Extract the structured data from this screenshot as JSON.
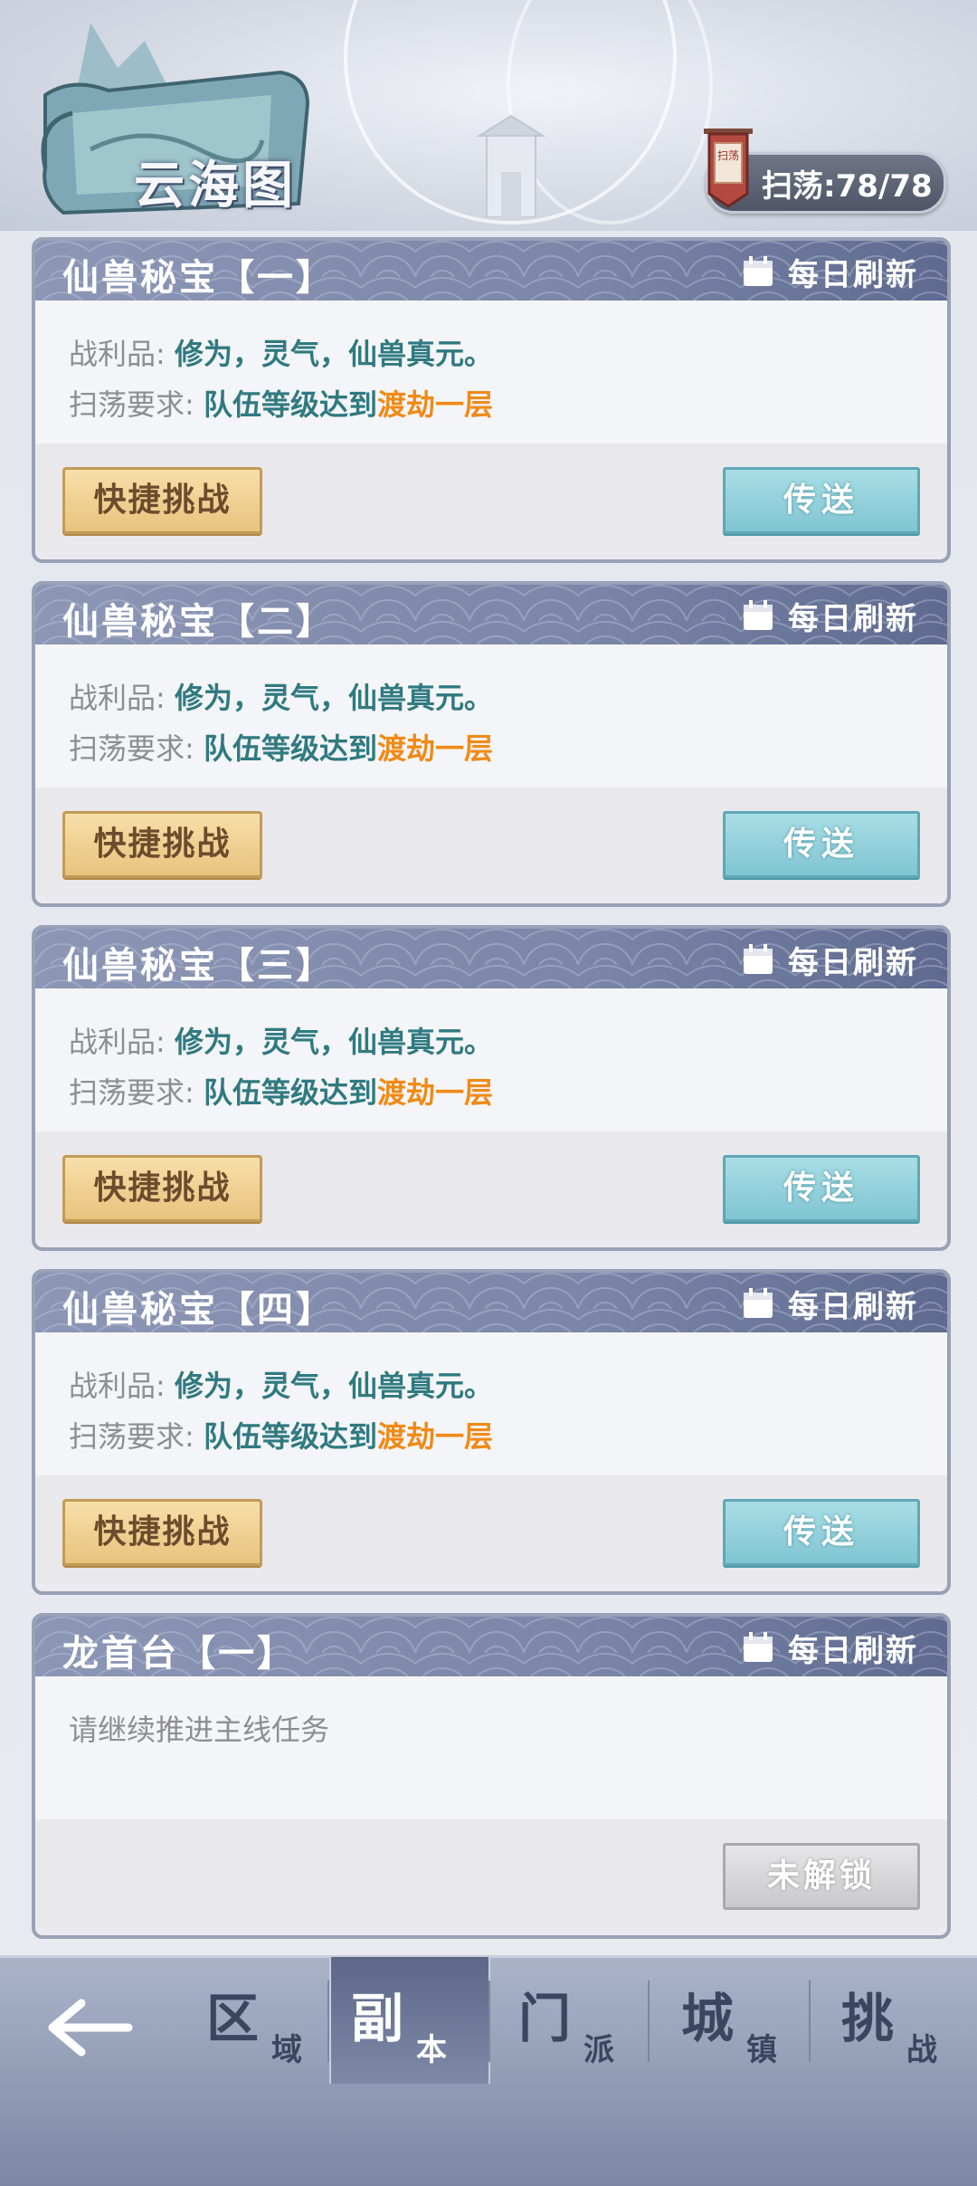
{
  "header": {
    "title": "云海图",
    "sweep_label": "扫荡:78/78",
    "banner_text": "扫荡"
  },
  "colors": {
    "accent_orange": "#f08a16",
    "value_teal": "#2f7a80",
    "header_bar": "#7b86a8"
  },
  "cards": [
    {
      "title": "仙兽秘宝【一】",
      "refresh_label": "每日刷新",
      "loot_label": "战利品:",
      "loot_value": "修为，灵气，仙兽真元。",
      "req_label": "扫荡要求:",
      "req_value": "队伍等级达到",
      "req_highlight": "渡劫一层",
      "left_button": "快捷挑战",
      "right_button": "传送"
    },
    {
      "title": "仙兽秘宝【二】",
      "refresh_label": "每日刷新",
      "loot_label": "战利品:",
      "loot_value": "修为，灵气，仙兽真元。",
      "req_label": "扫荡要求:",
      "req_value": "队伍等级达到",
      "req_highlight": "渡劫一层",
      "left_button": "快捷挑战",
      "right_button": "传送"
    },
    {
      "title": "仙兽秘宝【三】",
      "refresh_label": "每日刷新",
      "loot_label": "战利品:",
      "loot_value": "修为，灵气，仙兽真元。",
      "req_label": "扫荡要求:",
      "req_value": "队伍等级达到",
      "req_highlight": "渡劫一层",
      "left_button": "快捷挑战",
      "right_button": "传送"
    },
    {
      "title": "仙兽秘宝【四】",
      "refresh_label": "每日刷新",
      "loot_label": "战利品:",
      "loot_value": "修为，灵气，仙兽真元。",
      "req_label": "扫荡要求:",
      "req_value": "队伍等级达到",
      "req_highlight": "渡劫一层",
      "left_button": "快捷挑战",
      "right_button": "传送"
    },
    {
      "title": "龙首台【一】",
      "refresh_label": "每日刷新",
      "hint": "请继续推进主线任务",
      "locked_button": "未解锁"
    }
  ],
  "nav": {
    "back_icon": "arrow-left-icon",
    "items": [
      {
        "big": "区",
        "small": "域",
        "active": false
      },
      {
        "big": "副",
        "small": "本",
        "active": true
      },
      {
        "big": "门",
        "small": "派",
        "active": false
      },
      {
        "big": "城",
        "small": "镇",
        "active": false
      },
      {
        "big": "挑",
        "small": "战",
        "active": false
      }
    ]
  }
}
